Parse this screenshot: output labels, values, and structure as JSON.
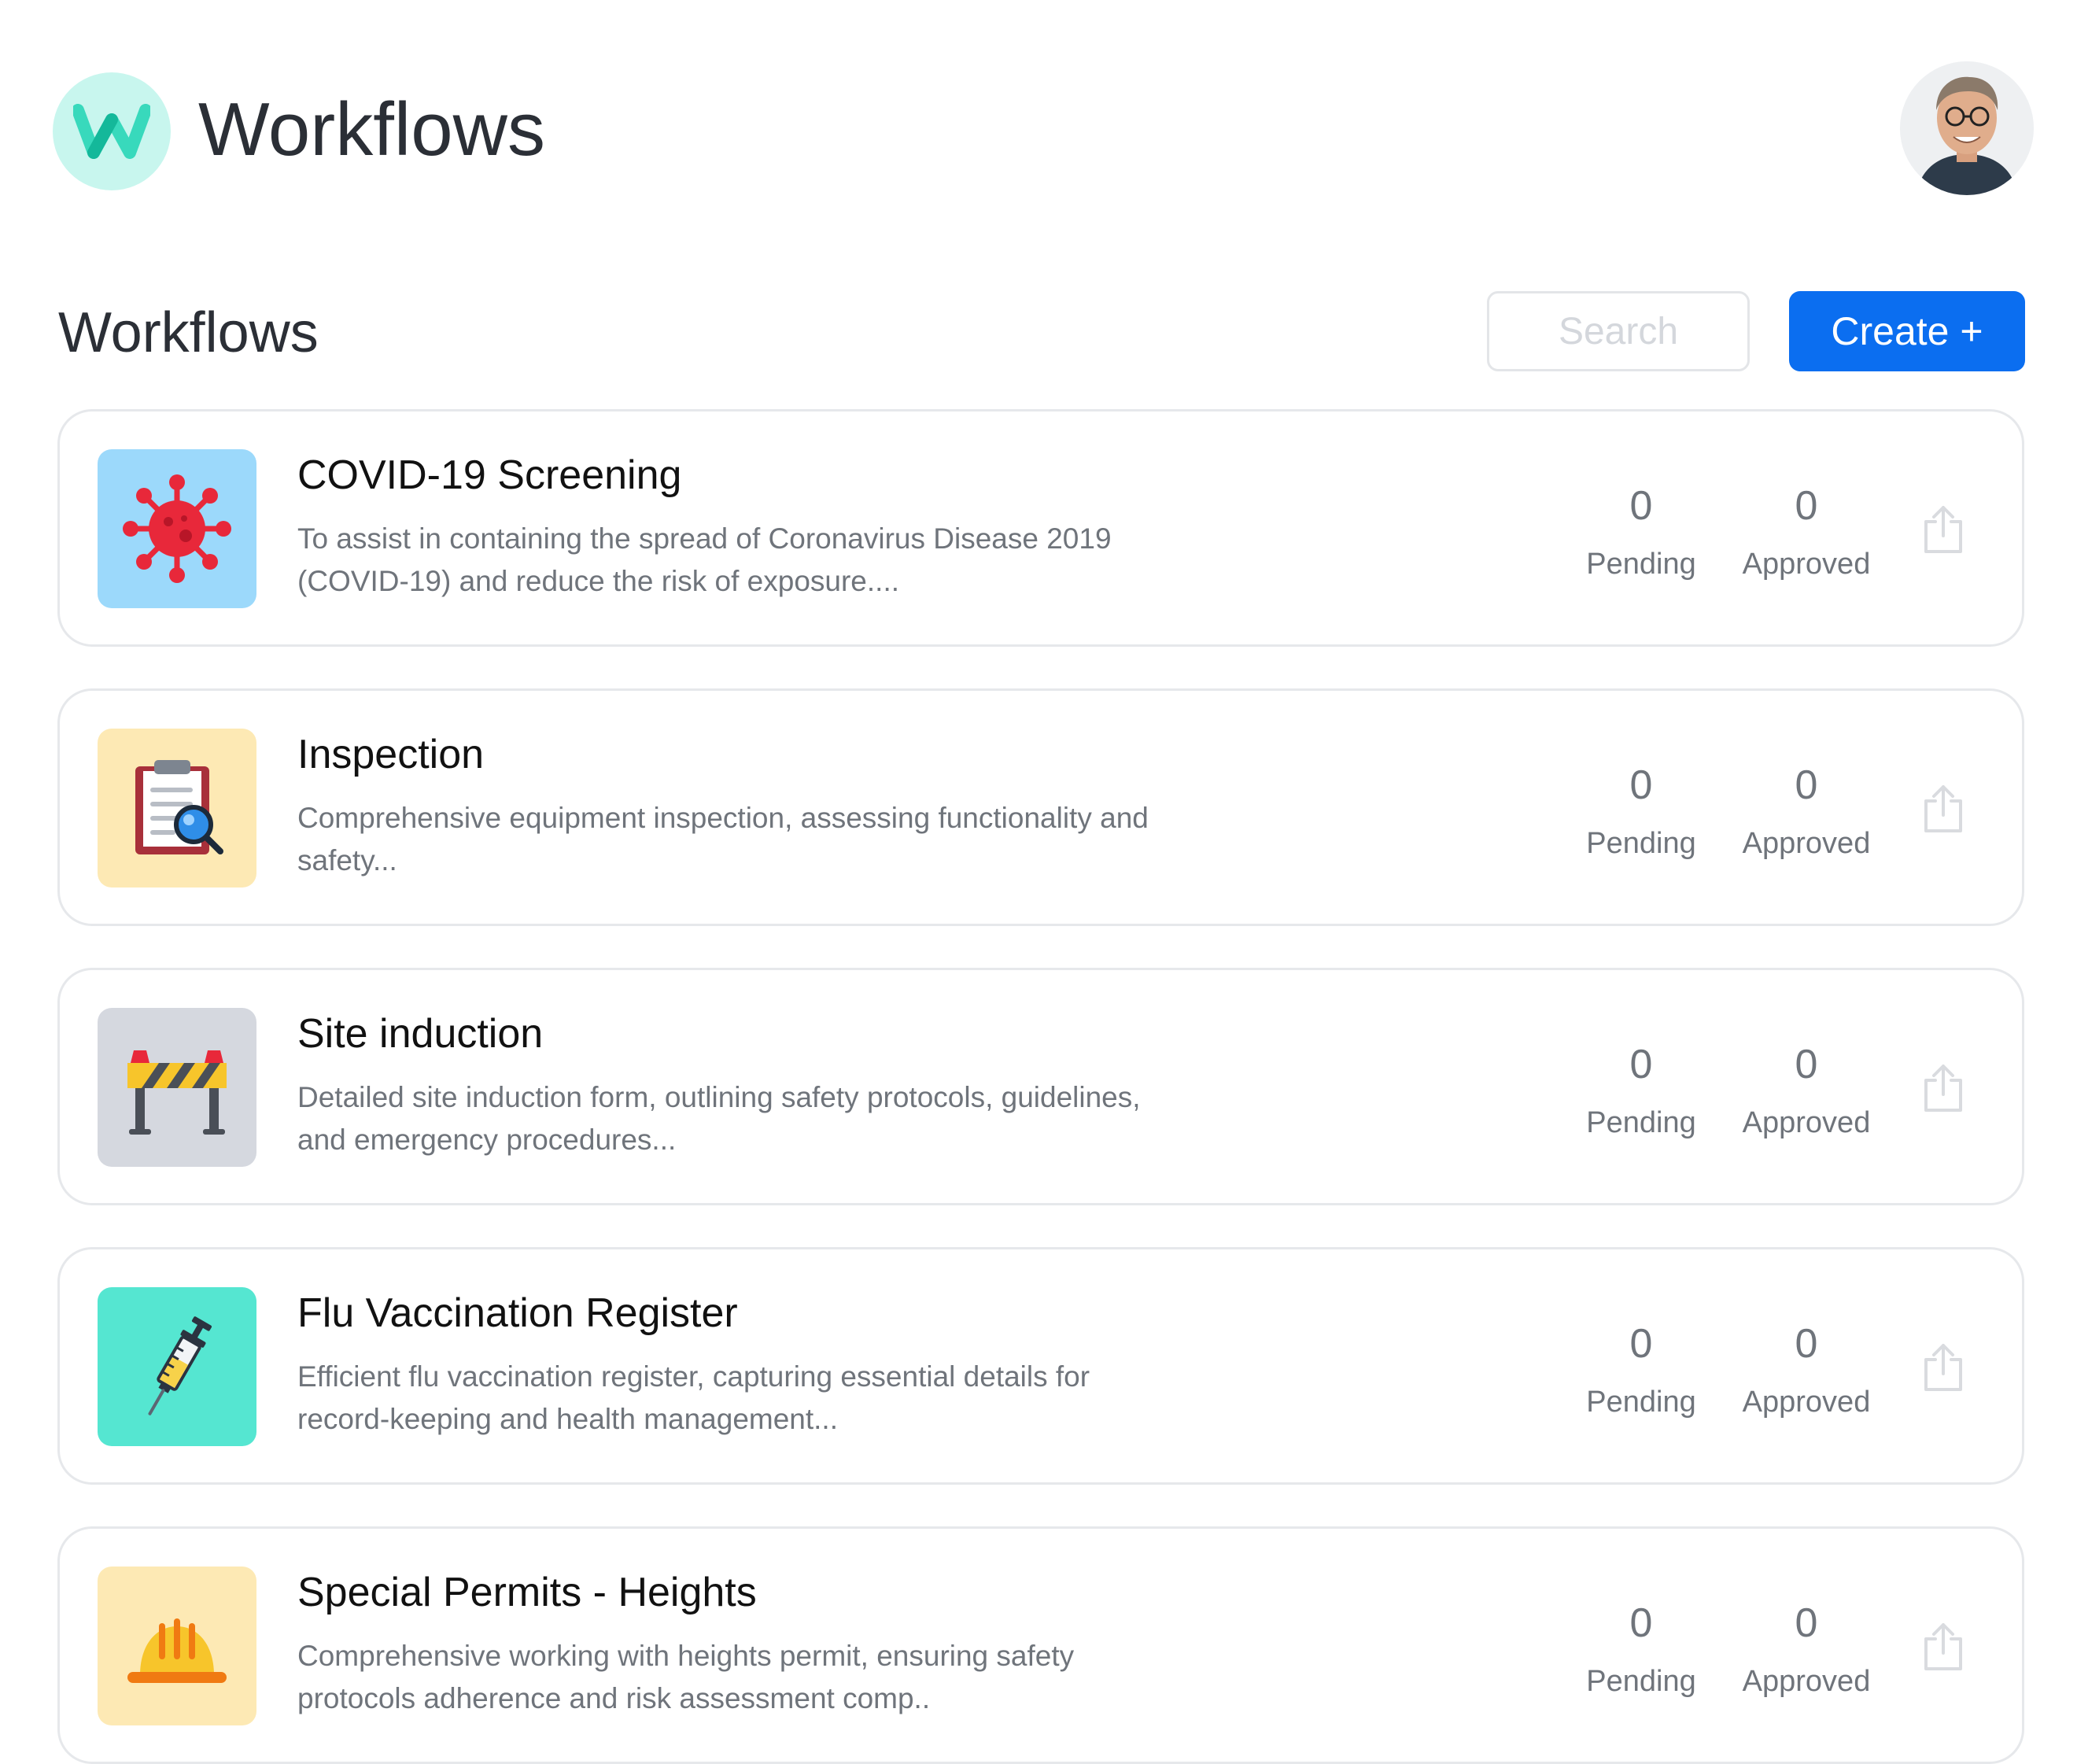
{
  "header": {
    "app_title": "Workflows",
    "logo_icon": "w-logo-icon",
    "avatar_icon": "user-avatar"
  },
  "toolbar": {
    "section_title": "Workflows",
    "search_placeholder": "Search",
    "create_label": "Create +"
  },
  "colors": {
    "primary": "#0b6ef0",
    "logo_bg": "#c8f6ee",
    "logo_fg": "#1fd4b3"
  },
  "workflows": [
    {
      "title": "COVID-19 Screening",
      "description": "To assist in containing the spread of Coronavirus Disease 2019 (COVID-19) and reduce the risk of exposure....",
      "icon": "virus-icon",
      "icon_bg": "#9cd9fb",
      "pending": "0",
      "pending_label": "Pending",
      "approved": "0",
      "approved_label": "Approved"
    },
    {
      "title": "Inspection",
      "description": "Comprehensive equipment inspection, assessing functionality and safety...",
      "icon": "clipboard-magnifier-icon",
      "icon_bg": "#fde9b4",
      "pending": "0",
      "pending_label": "Pending",
      "approved": "0",
      "approved_label": "Approved"
    },
    {
      "title": "Site induction",
      "description": "Detailed site induction form, outlining safety protocols, guidelines, and emergency procedures...",
      "icon": "road-barrier-icon",
      "icon_bg": "#d5d8df",
      "pending": "0",
      "pending_label": "Pending",
      "approved": "0",
      "approved_label": "Approved"
    },
    {
      "title": "Flu Vaccination Register",
      "description": "Efficient flu vaccination register, capturing essential details for record-keeping and health management...",
      "icon": "syringe-icon",
      "icon_bg": "#55e6d1",
      "pending": "0",
      "pending_label": "Pending",
      "approved": "0",
      "approved_label": "Approved"
    },
    {
      "title": "Special Permits - Heights",
      "description": "Comprehensive working with heights permit, ensuring safety protocols adherence and risk assessment comp..",
      "icon": "hard-hat-icon",
      "icon_bg": "#fde9b4",
      "pending": "0",
      "pending_label": "Pending",
      "approved": "0",
      "approved_label": "Approved"
    }
  ]
}
